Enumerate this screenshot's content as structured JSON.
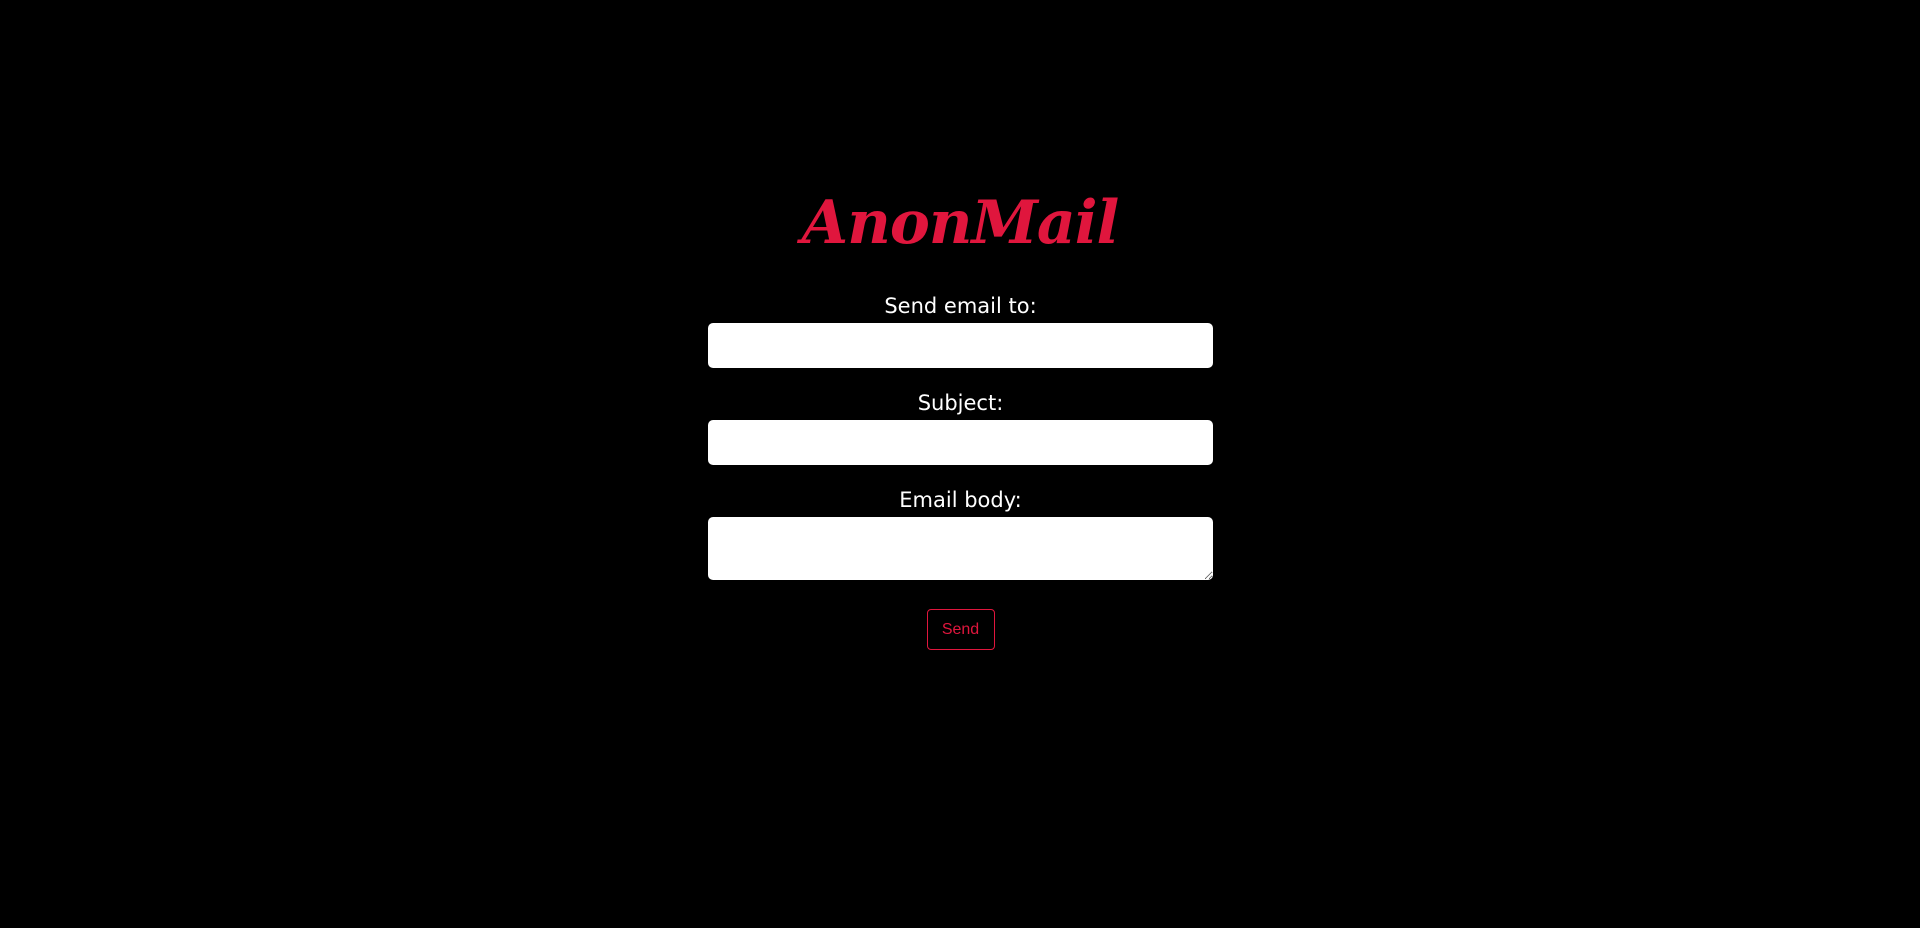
{
  "app": {
    "logo_text": "AnonMail"
  },
  "colors": {
    "background": "#000000",
    "accent": "#e0163d",
    "label_text": "#ffffff",
    "input_background": "#ffffff"
  },
  "form": {
    "to_label": "Send email to:",
    "to_value": "",
    "subject_label": "Subject:",
    "subject_value": "",
    "body_label": "Email body:",
    "body_value": "",
    "send_label": "Send"
  }
}
